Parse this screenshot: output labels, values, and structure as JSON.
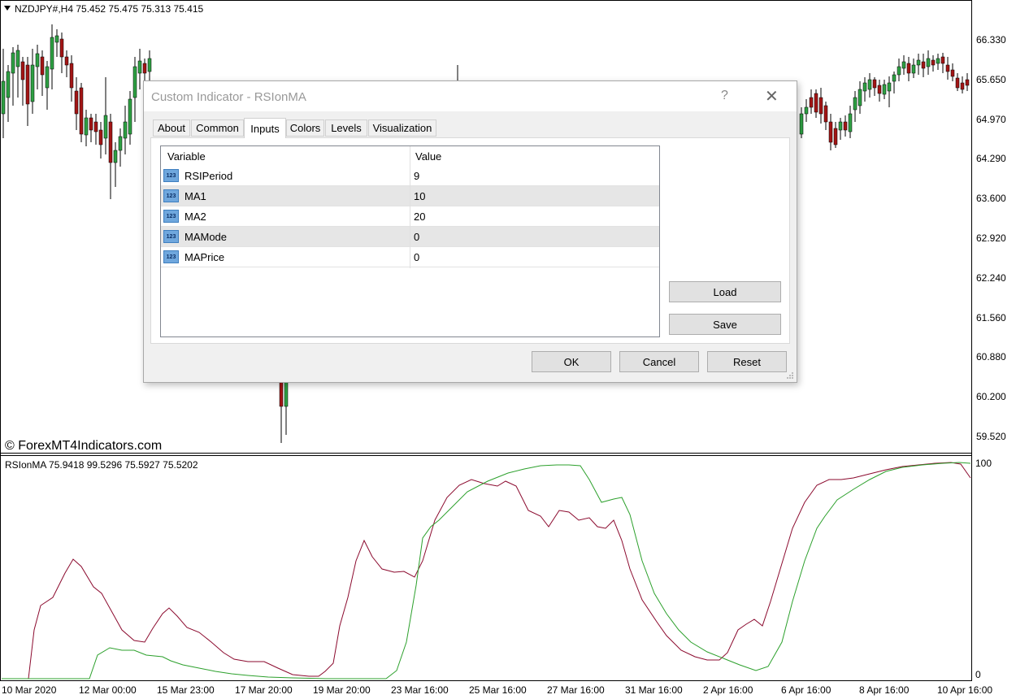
{
  "chart": {
    "symbol_title": "NZDJPY#,H4  75.452 75.475 75.313 75.415",
    "watermark": "© ForexMT4Indicators.com",
    "price_axis": [
      "66.330",
      "65.650",
      "64.970",
      "64.290",
      "63.600",
      "62.920",
      "62.240",
      "61.560",
      "60.880",
      "60.200",
      "59.520"
    ],
    "indicator_title": "RSIonMA 75.9418 99.5296 75.5927 75.5202",
    "indicator_axis": [
      "100",
      "0"
    ],
    "date_axis": [
      "10 Mar 2020",
      "12 Mar 00:00",
      "15 Mar 23:00",
      "17 Mar 20:00",
      "19 Mar 20:00",
      "23 Mar 16:00",
      "25 Mar 16:00",
      "27 Mar 16:00",
      "31 Mar 16:00",
      "2 Apr 16:00",
      "6 Apr 16:00",
      "8 Apr 16:00",
      "10 Apr 16:00"
    ],
    "colors": {
      "bull": "#2ea043",
      "bear": "#a31515",
      "rsi_line": "#8b0a2e",
      "ma_line": "#2ca02c"
    }
  },
  "dialog": {
    "title": "Custom Indicator - RSIonMA",
    "help_glyph": "?",
    "close_glyph": "✕",
    "tabs": [
      "About",
      "Common",
      "Inputs",
      "Colors",
      "Levels",
      "Visualization"
    ],
    "active_tab": "Inputs",
    "grid": {
      "headers": [
        "Variable",
        "Value"
      ],
      "icon_text": "123",
      "rows": [
        {
          "variable": "RSIPeriod",
          "value": "9"
        },
        {
          "variable": "MA1",
          "value": "10"
        },
        {
          "variable": "MA2",
          "value": "20"
        },
        {
          "variable": "MAMode",
          "value": "0"
        },
        {
          "variable": "MAPrice",
          "value": "0"
        }
      ]
    },
    "buttons": {
      "load": "Load",
      "save": "Save",
      "ok": "OK",
      "cancel": "Cancel",
      "reset": "Reset"
    }
  }
}
